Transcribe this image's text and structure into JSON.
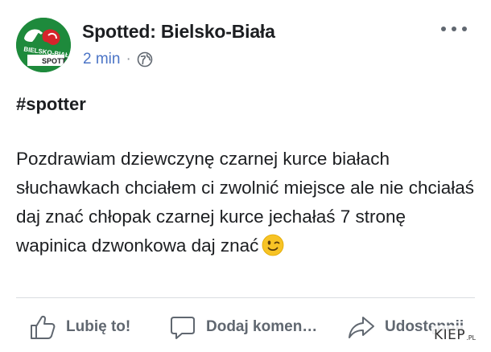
{
  "post": {
    "page_name": "Spotted: Bielsko-Biała",
    "time": "2 min",
    "separator": "·",
    "privacy_icon": "globe-icon",
    "avatar_text_top": "BIELSKO-BIAŁA",
    "avatar_text_bottom": "SPOTTED",
    "hashtag": "#spotter",
    "body": "Pozdrawiam dziewczynę czarnej kurce białach słuchawkach chciałem ci zwolnić miejsce ale nie chciałaś daj znać chłopak czarnej kurce jechałaś 7 stronę wapinica dzwonkowa daj znać",
    "emoji": "winking-face-emoji"
  },
  "actions": {
    "like_label": "Lubię to!",
    "comment_label": "Dodaj komen…",
    "share_label": "Udostępnij"
  },
  "watermark": {
    "main": "KIEP",
    "sub": ".PL"
  },
  "colors": {
    "link_blue": "#4b74c6",
    "action_gray": "#606770",
    "avatar_green": "#1e8a3c",
    "logo_red": "#d6242b"
  }
}
